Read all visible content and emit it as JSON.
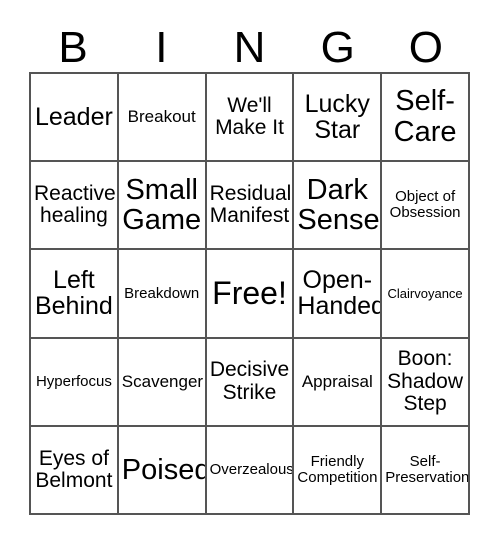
{
  "card": {
    "title_letters": [
      "B",
      "I",
      "N",
      "G",
      "O"
    ],
    "columns": 5,
    "rows": 5,
    "background_color": "#ffffff",
    "text_color": "#000000",
    "border_color": "#555555",
    "free_space": "Free!",
    "cells": [
      [
        {
          "label": "Leader",
          "size": "xl"
        },
        {
          "label": "Breakout",
          "size": "md"
        },
        {
          "label": "We'll\nMake It",
          "size": "lg"
        },
        {
          "label": "Lucky\nStar",
          "size": "xl"
        },
        {
          "label": "Self-\nCare",
          "size": "xxl"
        }
      ],
      [
        {
          "label": "Reactive\nhealing",
          "size": "lg"
        },
        {
          "label": "Small\nGame",
          "size": "xxl"
        },
        {
          "label": "Residual\nManifest",
          "size": "lg"
        },
        {
          "label": "Dark\nSense",
          "size": "xxl"
        },
        {
          "label": "Object of\nObsession",
          "size": "sm"
        }
      ],
      [
        {
          "label": "Left\nBehind",
          "size": "xl"
        },
        {
          "label": "Breakdown",
          "size": "sm"
        },
        {
          "label": "Free!",
          "size": "free"
        },
        {
          "label": "Open-\nHanded",
          "size": "xl"
        },
        {
          "label": "Clairvoyance",
          "size": "xs"
        }
      ],
      [
        {
          "label": "Hyperfocus",
          "size": "sm"
        },
        {
          "label": "Scavenger",
          "size": "md"
        },
        {
          "label": "Decisive\nStrike",
          "size": "lg"
        },
        {
          "label": "Appraisal",
          "size": "md"
        },
        {
          "label": "Boon:\nShadow\nStep",
          "size": "lg"
        }
      ],
      [
        {
          "label": "Eyes of\nBelmont",
          "size": "lg"
        },
        {
          "label": "Poised",
          "size": "xxl"
        },
        {
          "label": "Overzealous",
          "size": "sm"
        },
        {
          "label": "Friendly\nCompetition",
          "size": "sm"
        },
        {
          "label": "Self-\nPreservation",
          "size": "sm"
        }
      ]
    ]
  }
}
